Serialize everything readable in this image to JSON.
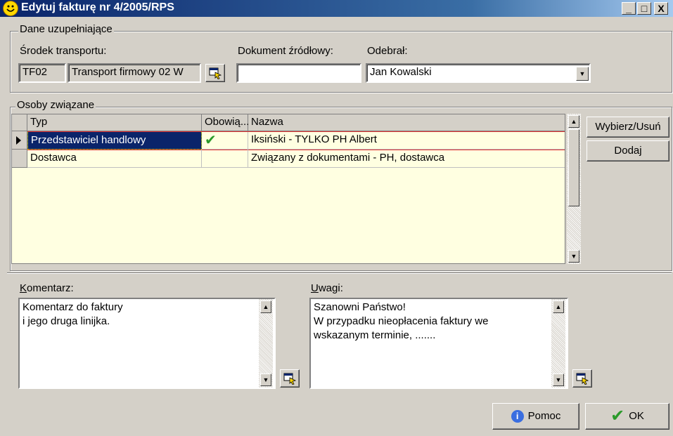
{
  "window": {
    "title": "Edytuj fakturę nr 4/2005/RPS",
    "min_label": "_",
    "max_label": "□",
    "close_label": "X"
  },
  "dane": {
    "legend": "Dane uzupełniające",
    "transport_label": "Środek transportu:",
    "transport_code": "TF02",
    "transport_name": "Transport firmowy 02 W",
    "dokument_label": "Dokument źródłowy:",
    "dokument_value": "",
    "odebral_label": "Odebrał:",
    "odebral_value": "Jan Kowalski"
  },
  "osoby": {
    "legend": "Osoby związane",
    "columns": [
      "Typ",
      "Obowią...",
      "Nazwa"
    ],
    "rows": [
      {
        "typ": "Przedstawiciel handlowy",
        "obowiazkowy": "✔",
        "nazwa": "Iksiński - TYLKO PH Albert"
      },
      {
        "typ": "Dostawca",
        "obowiazkowy": "",
        "nazwa": "Związany z dokumentami - PH, dostawca"
      }
    ],
    "wybierz_label": "Wybierz/Usuń",
    "dodaj_label": "Dodaj"
  },
  "komentarz": {
    "label": "Komentarz:",
    "lines": [
      "Komentarz do faktury",
      "i jego druga linijka."
    ]
  },
  "uwagi": {
    "label": "Uwagi:",
    "lines": [
      "Szanowni Państwo!",
      "W przypadku nieopłacenia faktury we",
      "wskazanym terminie, ......."
    ]
  },
  "footer": {
    "pomoc_label": "Pomoc",
    "ok_label": "OK"
  },
  "colors": {
    "titlebar": "#0a246a",
    "grid_background": "#ffffe1",
    "selection": "#0a246a",
    "checkmark": "#2a9a2a",
    "focus_row_border": "#e03030"
  }
}
